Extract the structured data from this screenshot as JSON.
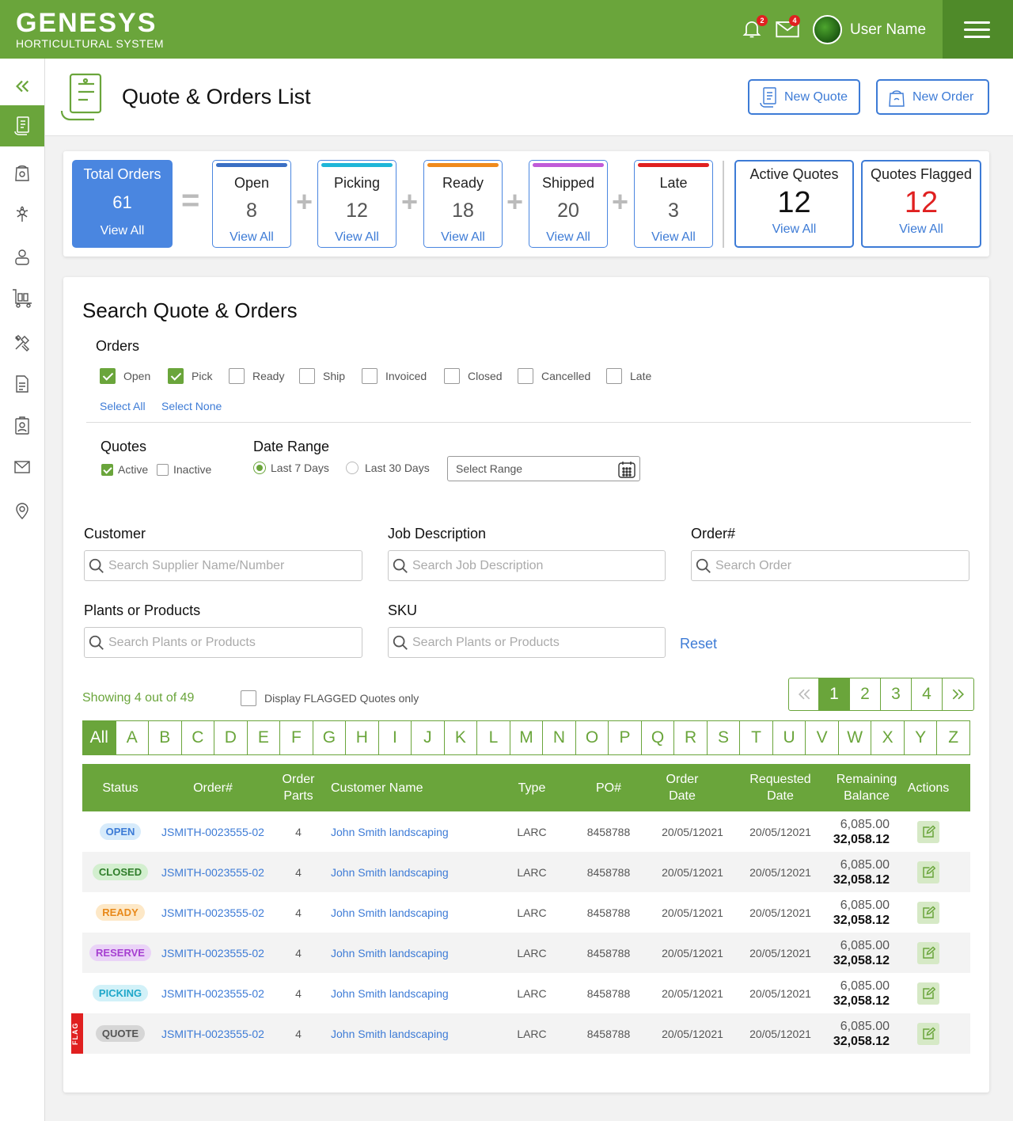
{
  "app": {
    "brand": "GENESYS",
    "tagline": "HORTICULTURAL SYSTEM",
    "notifications_count": "2",
    "messages_count": "4",
    "user_name": "User Name"
  },
  "header": {
    "title": "Quote & Orders List",
    "new_quote": "New Quote",
    "new_order": "New Order"
  },
  "stats": {
    "total": {
      "title": "Total Orders",
      "value": "61",
      "link": "View All"
    },
    "equals": "=",
    "plus": "+",
    "open": {
      "title": "Open",
      "value": "8",
      "link": "View All",
      "color": "#3a6fc4"
    },
    "picking": {
      "title": "Picking",
      "value": "12",
      "link": "View All",
      "color": "#1fb6d8"
    },
    "ready": {
      "title": "Ready",
      "value": "18",
      "link": "View All",
      "color": "#f08a1c"
    },
    "shipped": {
      "title": "Shipped",
      "value": "20",
      "link": "View All",
      "color": "#c05bd8"
    },
    "late": {
      "title": "Late",
      "value": "3",
      "link": "View All",
      "color": "#e02020"
    },
    "active_quotes": {
      "title": "Active Quotes",
      "value": "12",
      "link": "View All"
    },
    "quotes_flagged": {
      "title": "Quotes Flagged",
      "value": "12",
      "link": "View All"
    }
  },
  "search": {
    "title": "Search Quote & Orders",
    "orders_label": "Orders",
    "order_filters": [
      {
        "label": "Open",
        "checked": true
      },
      {
        "label": "Pick",
        "checked": true
      },
      {
        "label": "Ready",
        "checked": false
      },
      {
        "label": "Ship",
        "checked": false
      },
      {
        "label": "Invoiced",
        "checked": false
      },
      {
        "label": "Closed",
        "checked": false
      },
      {
        "label": "Cancelled",
        "checked": false
      },
      {
        "label": "Late",
        "checked": false
      }
    ],
    "select_all": "Select All",
    "select_none": "Select None",
    "quotes_label": "Quotes",
    "quote_active": "Active",
    "quote_inactive": "Inactive",
    "date_range_label": "Date Range",
    "last7": "Last 7 Days",
    "last30": "Last 30 Days",
    "range_placeholder": "Select Range",
    "customer_label": "Customer",
    "customer_placeholder": "Search Supplier Name/Number",
    "job_label": "Job Description",
    "job_placeholder": "Search Job Description",
    "order_label": "Order#",
    "order_placeholder": "Search Order",
    "plants_label": "Plants or Products",
    "plants_placeholder": "Search Plants or Products",
    "sku_label": "SKU",
    "sku_placeholder": "Search Plants or Products",
    "reset": "Reset"
  },
  "results": {
    "showing": "Showing 4 out of 49",
    "flagged_only": "Display FLAGGED Quotes only",
    "pages": [
      "1",
      "2",
      "3",
      "4"
    ],
    "current_page": "1",
    "alphabet": [
      "All",
      "A",
      "B",
      "C",
      "D",
      "E",
      "F",
      "G",
      "H",
      "I",
      "J",
      "K",
      "L",
      "M",
      "N",
      "O",
      "P",
      "Q",
      "R",
      "S",
      "T",
      "U",
      "V",
      "W",
      "X",
      "Y",
      "Z"
    ]
  },
  "table": {
    "headers": {
      "status": "Status",
      "order": "Order#",
      "parts": "Order Parts",
      "customer": "Customer Name",
      "type": "Type",
      "po": "PO#",
      "order_date": "Order Date",
      "requested_date": "Requested Date",
      "balance": "Remaining Balance",
      "actions": "Actions"
    },
    "flag_label": "FLAG",
    "rows": [
      {
        "status": "OPEN",
        "status_bg": "#d7ebfb",
        "status_fg": "#3d7bd6",
        "order": "JSMITH-0023555-02",
        "parts": "4",
        "customer": "John Smith landscaping",
        "type": "LARC",
        "po": "8458788",
        "order_date": "20/05/12021",
        "requested_date": "20/05/12021",
        "bal1": "6,085.00",
        "bal2": "32,058.12",
        "flag": false
      },
      {
        "status": "CLOSED",
        "status_bg": "#d3efcf",
        "status_fg": "#2f7d2a",
        "order": "JSMITH-0023555-02",
        "parts": "4",
        "customer": "John Smith landscaping",
        "type": "LARC",
        "po": "8458788",
        "order_date": "20/05/12021",
        "requested_date": "20/05/12021",
        "bal1": "6,085.00",
        "bal2": "32,058.12",
        "flag": false
      },
      {
        "status": "READY",
        "status_bg": "#fde8c7",
        "status_fg": "#e8891a",
        "order": "JSMITH-0023555-02",
        "parts": "4",
        "customer": "John Smith landscaping",
        "type": "LARC",
        "po": "8458788",
        "order_date": "20/05/12021",
        "requested_date": "20/05/12021",
        "bal1": "6,085.00",
        "bal2": "32,058.12",
        "flag": false
      },
      {
        "status": "RESERVE",
        "status_bg": "#ead3f7",
        "status_fg": "#a63fd1",
        "order": "JSMITH-0023555-02",
        "parts": "4",
        "customer": "John Smith landscaping",
        "type": "LARC",
        "po": "8458788",
        "order_date": "20/05/12021",
        "requested_date": "20/05/12021",
        "bal1": "6,085.00",
        "bal2": "32,058.12",
        "flag": false
      },
      {
        "status": "PICKING",
        "status_bg": "#d2f1f8",
        "status_fg": "#1ea7c9",
        "order": "JSMITH-0023555-02",
        "parts": "4",
        "customer": "John Smith landscaping",
        "type": "LARC",
        "po": "8458788",
        "order_date": "20/05/12021",
        "requested_date": "20/05/12021",
        "bal1": "6,085.00",
        "bal2": "32,058.12",
        "flag": false
      },
      {
        "status": "QUOTE",
        "status_bg": "#d6d6d6",
        "status_fg": "#555555",
        "order": "JSMITH-0023555-02",
        "parts": "4",
        "customer": "John Smith landscaping",
        "type": "LARC",
        "po": "8458788",
        "order_date": "20/05/12021",
        "requested_date": "20/05/12021",
        "bal1": "6,085.00",
        "bal2": "32,058.12",
        "flag": true
      }
    ]
  },
  "sidebar": {
    "icons": [
      "collapse-icon",
      "quotes-icon",
      "seed-bag-icon",
      "plant-icon",
      "contacts-icon",
      "cart-icon",
      "tools-icon",
      "document-icon",
      "clipboard-icon",
      "mail-icon",
      "location-icon"
    ]
  }
}
